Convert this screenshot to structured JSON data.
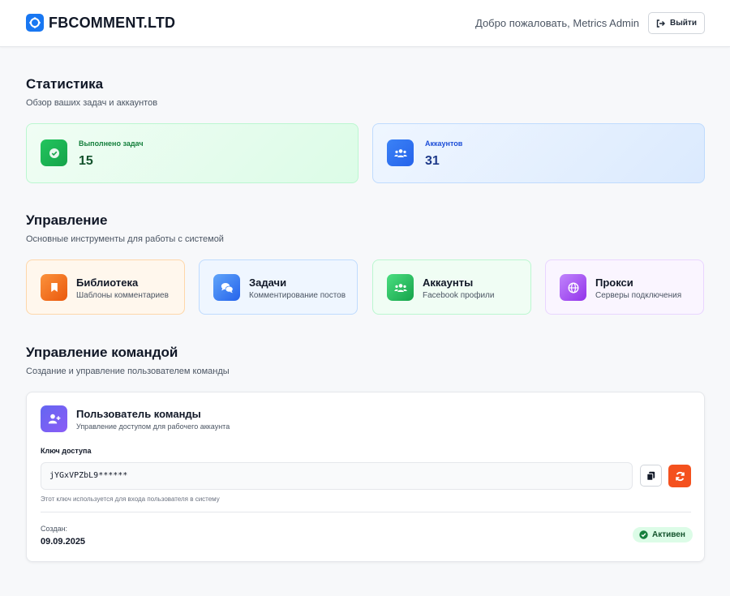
{
  "header": {
    "brand": "FBCOMMENT.LTD",
    "welcome": "Добро пожаловать, Metrics Admin",
    "logout_label": "Выйти"
  },
  "stats": {
    "title": "Статистика",
    "subtitle": "Обзор ваших задач и аккаунтов",
    "cards": [
      {
        "label": "Выполнено задач",
        "value": "15",
        "icon": "check-circle-icon",
        "color": "#16a34a"
      },
      {
        "label": "Аккаунтов",
        "value": "31",
        "icon": "users-icon",
        "color": "#2563eb"
      }
    ]
  },
  "management": {
    "title": "Управление",
    "subtitle": "Основные инструменты для работы с системой",
    "tools": [
      {
        "title": "Библиотека",
        "subtitle": "Шаблоны комментариев",
        "icon": "bookmark-icon",
        "color": "#f97316"
      },
      {
        "title": "Задачи",
        "subtitle": "Комментирование постов",
        "icon": "comments-icon",
        "color": "#3b82f6"
      },
      {
        "title": "Аккаунты",
        "subtitle": "Facebook профили",
        "icon": "users-icon",
        "color": "#22c55e"
      },
      {
        "title": "Прокси",
        "subtitle": "Серверы подключения",
        "icon": "globe-icon",
        "color": "#a855f7"
      }
    ]
  },
  "team": {
    "title": "Управление командой",
    "subtitle": "Создание и управление пользователем команды",
    "card": {
      "title": "Пользователь команды",
      "subtitle": "Управление доступом для рабочего аккаунта",
      "key_label": "Ключ доступа",
      "key_value": "jYGxVPZbL9******",
      "key_hint": "Этот ключ используется для входа пользователя в систему",
      "created_label": "Создан:",
      "created_value": "09.09.2025",
      "status": "Активен"
    }
  }
}
